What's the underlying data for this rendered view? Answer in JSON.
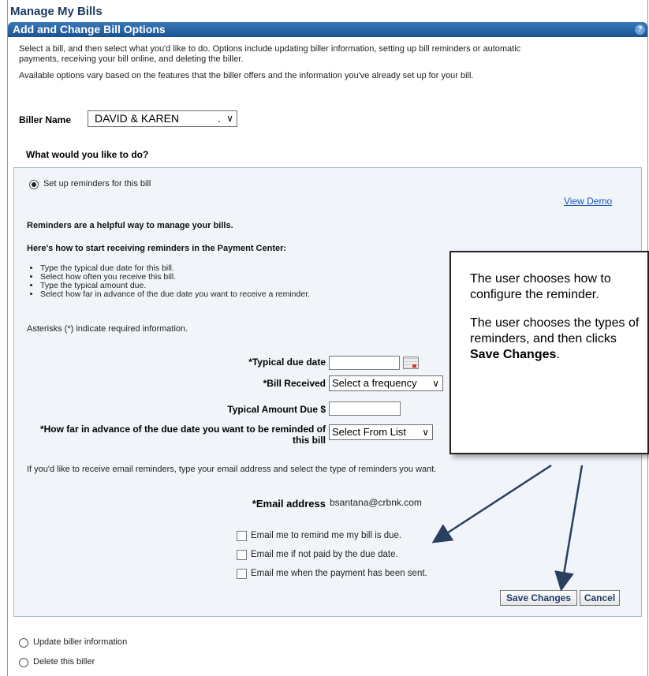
{
  "page": {
    "title": "Manage My Bills",
    "section_title": "Add and Change Bill Options",
    "help_glyph": "?"
  },
  "intro": {
    "line1": "Select a bill, and then select what you'd like to do. Options include updating biller information, setting up bill reminders or automatic",
    "line2": "payments, receiving your bill online, and deleting the biller.",
    "line3": "Available options vary based on the features that the biller offers and the information you've already set up for your bill."
  },
  "biller": {
    "label": "Biller Name",
    "selected": "DAVID & KAREN",
    "suffix": "."
  },
  "question": "What would you like to do?",
  "options": {
    "reminders": {
      "label": "Set up reminders for this bill",
      "selected": true
    },
    "update": {
      "label": "Update biller information",
      "selected": false
    },
    "delete": {
      "label": "Delete this biller",
      "selected": false
    }
  },
  "view_demo": "View Demo",
  "reminders": {
    "heading": "Reminders are a helpful way to manage your bills.",
    "subheading": "Here's how to start receiving reminders in the Payment Center:",
    "steps": [
      "Type the typical due date for this bill.",
      "Select how often you receive this bill.",
      "Type the typical amount due.",
      "Select how far in advance of the due date you want to receive a reminder."
    ],
    "asterisk_note": "Asterisks (*) indicate required information."
  },
  "form": {
    "due_date_label": "*Typical due date",
    "bill_received_label": "*Bill Received",
    "bill_received_value": "Select a frequency",
    "amount_label": "Typical Amount Due $",
    "advance_label_1": "*How far in advance of the due date you want to be reminded of",
    "advance_label_2": "this bill",
    "advance_value": "Select From List"
  },
  "email": {
    "intro": "If you'd like to receive email reminders, type your email address and select the type of reminders you want.",
    "label": "*Email address",
    "value": "bsantana@crbnk.com",
    "checks": [
      {
        "label": "Email me to remind me my bill is due.",
        "checked": false
      },
      {
        "label": "Email me if not paid by the due date.",
        "checked": false
      },
      {
        "label": "Email me when the payment has been sent.",
        "checked": false
      }
    ]
  },
  "buttons": {
    "save": "Save Changes",
    "cancel": "Cancel"
  },
  "callout": {
    "para1": "The user chooses how to configure the reminder.",
    "para2_pre": "The user chooses the types of reminders, and then clicks ",
    "para2_bold": "Save Changes",
    "para2_post": "."
  },
  "colors": {
    "header_blue": "#1b5392",
    "link": "#1a56b0",
    "panel_bg": "#f1f5fa"
  },
  "icons": {
    "calendar": "calendar-icon",
    "chevron": "chevron-down-icon",
    "help": "help-icon"
  }
}
